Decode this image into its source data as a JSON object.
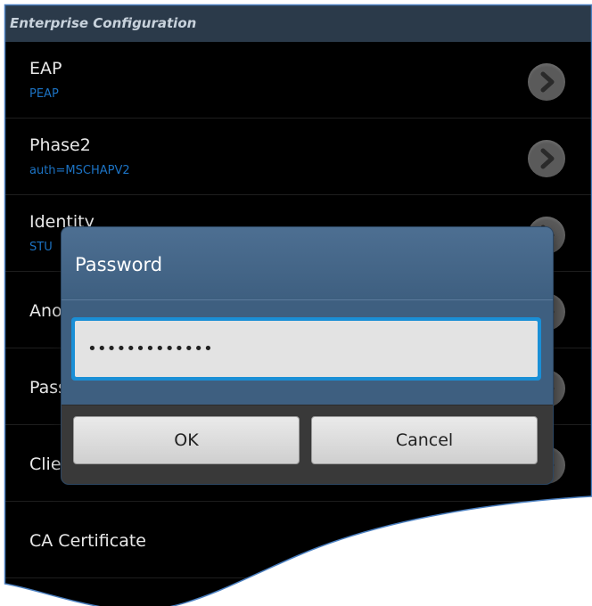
{
  "header": {
    "title": "Enterprise Configuration"
  },
  "settings": [
    {
      "title": "EAP",
      "value": "PEAP"
    },
    {
      "title": "Phase2",
      "value": "auth=MSCHAPV2"
    },
    {
      "title": "Identity",
      "value": "STU"
    },
    {
      "title": "Anonymous identity",
      "value": ""
    },
    {
      "title": "Password",
      "value": ""
    },
    {
      "title": "Client certificate",
      "value": ""
    },
    {
      "title": "CA Certificate",
      "value": ""
    }
  ],
  "dialog": {
    "title": "Password",
    "password_value": "•••••••••••••",
    "ok_label": "OK",
    "cancel_label": "Cancel"
  },
  "icons": {
    "row_action": "chevron-right-icon"
  },
  "colors": {
    "header_bg": "#2b3a4a",
    "value_text": "#1c73c4",
    "dialog_bg": "#3e5f80",
    "input_focus": "#1a8fd6",
    "frame_edge": "#4a7fc0"
  }
}
